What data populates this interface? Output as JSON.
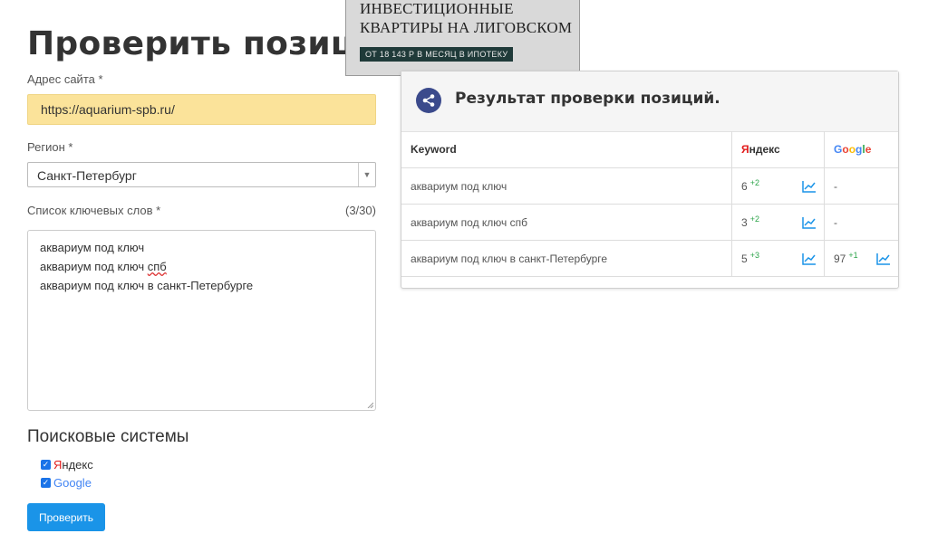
{
  "page": {
    "title": "Проверить позиции сайта"
  },
  "form": {
    "url_label": "Адрес сайта *",
    "url_value": "https://aquarium-spb.ru/",
    "region_label": "Регион *",
    "region_value": "Санкт-Петербург",
    "keywords_label": "Список ключевых слов *",
    "keywords_counter": "(3/30)",
    "keywords": [
      "аквариум под ключ",
      "аквариум под ключ",
      "спб",
      "аквариум под ключ в санкт-Петербурге"
    ],
    "engines_title": "Поисковые системы",
    "engines": [
      {
        "label_first": "Я",
        "label_rest": "ндекс",
        "checked": true
      },
      {
        "label": "Google",
        "checked": true
      }
    ],
    "submit_label": "Проверить"
  },
  "ad": {
    "line1": "ИНВЕСТИЦИОННЫЕ",
    "line2": "КВАРТИРЫ НА ЛИГОВСКОМ",
    "strip": "ОТ 18 143 Р В МЕСЯЦ В ИПОТЕКУ"
  },
  "results": {
    "title": "Результат проверки позиций.",
    "columns": {
      "keyword": "Keyword",
      "yandex_first": "Я",
      "yandex_rest": "ндекс",
      "google": [
        "G",
        "o",
        "o",
        "g",
        "l",
        "e"
      ]
    },
    "rows": [
      {
        "keyword": "аквариум под ключ",
        "yandex_pos": "6",
        "yandex_delta": "+2",
        "google_pos": "-",
        "google_delta": ""
      },
      {
        "keyword": "аквариум под ключ спб",
        "yandex_pos": "3",
        "yandex_delta": "+2",
        "google_pos": "-",
        "google_delta": ""
      },
      {
        "keyword": "аквариум под ключ в санкт-Петербурге",
        "yandex_pos": "5",
        "yandex_delta": "+3",
        "google_pos": "97",
        "google_delta": "+1"
      }
    ]
  },
  "colors": {
    "url_field_bg": "#fbe39a",
    "button_bg": "#1a94e8",
    "yandex_red": "#e21d1d",
    "delta_green": "#2ca44a",
    "trend_icon": "#1a94e8"
  }
}
